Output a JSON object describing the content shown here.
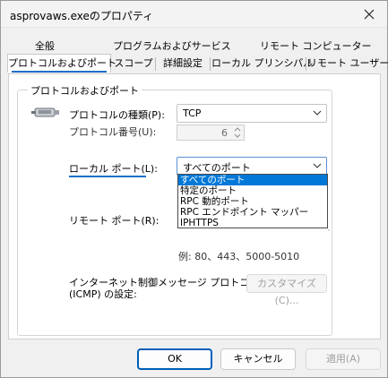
{
  "window": {
    "title": "asprovaws.exeのプロパティ"
  },
  "tabs": {
    "top_row": [
      "全般",
      "プログラムおよびサービス",
      "リモート コンピューター"
    ],
    "bottom_row": [
      "プロトコルおよびポート",
      "スコープ",
      "詳細設定",
      "ローカル プリンシパル",
      "リモート ユーザー"
    ],
    "active": "プロトコルおよびポート"
  },
  "group": {
    "legend": "プロトコルおよびポート"
  },
  "form": {
    "protocol_type_label": "プロトコルの種類(P):",
    "protocol_type_value": "TCP",
    "protocol_number_label": "プロトコル番号(U):",
    "protocol_number_value": "6",
    "local_port_label": "ローカル ポート(L):",
    "local_port_value": "すべてのポート",
    "remote_port_label": "リモート ポート(R):",
    "example_text": "例: 80、443、5000-5010",
    "icmp_label_line1": "インターネット制御メッセージ プロトコル",
    "icmp_label_line2": "(ICMP) の設定:",
    "customize_button": "カスタマイズ(C)..."
  },
  "dropdown": {
    "options": [
      "すべてのポート",
      "特定のポート",
      "RPC 動的ポート",
      "RPC エンドポイント マッパー",
      "IPHTTPS"
    ],
    "selected_index": 0
  },
  "buttons": {
    "ok": "OK",
    "cancel": "キャンセル",
    "apply": "適用(A)"
  },
  "colors": {
    "accent": "#005fb8",
    "selection": "#0078d7",
    "underline": "#1e6fc9"
  }
}
